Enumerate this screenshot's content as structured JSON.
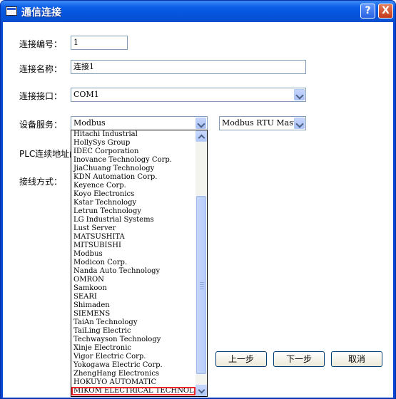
{
  "window": {
    "title": "通信连接"
  },
  "form": {
    "conn_number": {
      "label": "连接编号：",
      "value": "1"
    },
    "conn_name": {
      "label": "连接名称：",
      "value": "连接1"
    },
    "conn_port": {
      "label": "连接接口：",
      "value": "COM1"
    },
    "device_service": {
      "label": "设备服务：",
      "value": "Modbus"
    },
    "protocol": {
      "value": "Modbus RTU Master"
    },
    "plc_address": {
      "label": "PLC连续地址间"
    },
    "wiring": {
      "label": "接线方式："
    }
  },
  "dropdown": {
    "items": [
      "Hitachi Industrial",
      "HollySys Group",
      "IDEC Corporation",
      "Inovance Technology Corp.",
      "JiaChuang Technology",
      "KDN Automation Corp.",
      "Keyence Corp.",
      "Koyo Electronics",
      "Kstar Technology",
      "Letrun Technology",
      "LG Industrial Systems",
      "Lust Server",
      "MATSUSHITA",
      "MITSUBISHI",
      "Modbus",
      "Modicon Corp.",
      "Nanda Auto Technology",
      "OMRON",
      "Samkoon",
      "SEARI",
      "Shimaden",
      "SIEMENS",
      "TaiAn Technology",
      "TaiLing Electric",
      "Techwayson Technology",
      "Xinje Electronic",
      "Vigor Electric Corp.",
      "Yokogawa Electric Corp.",
      "ZhengHang Electronics",
      "HOKUYO AUTOMATIC",
      "MIKOM ELECTRICAL TECHNOLOGY"
    ]
  },
  "buttons": {
    "prev": "上一步",
    "next": "下一步",
    "cancel": "取消"
  },
  "titlebar": {
    "help": "?",
    "close": "X"
  }
}
